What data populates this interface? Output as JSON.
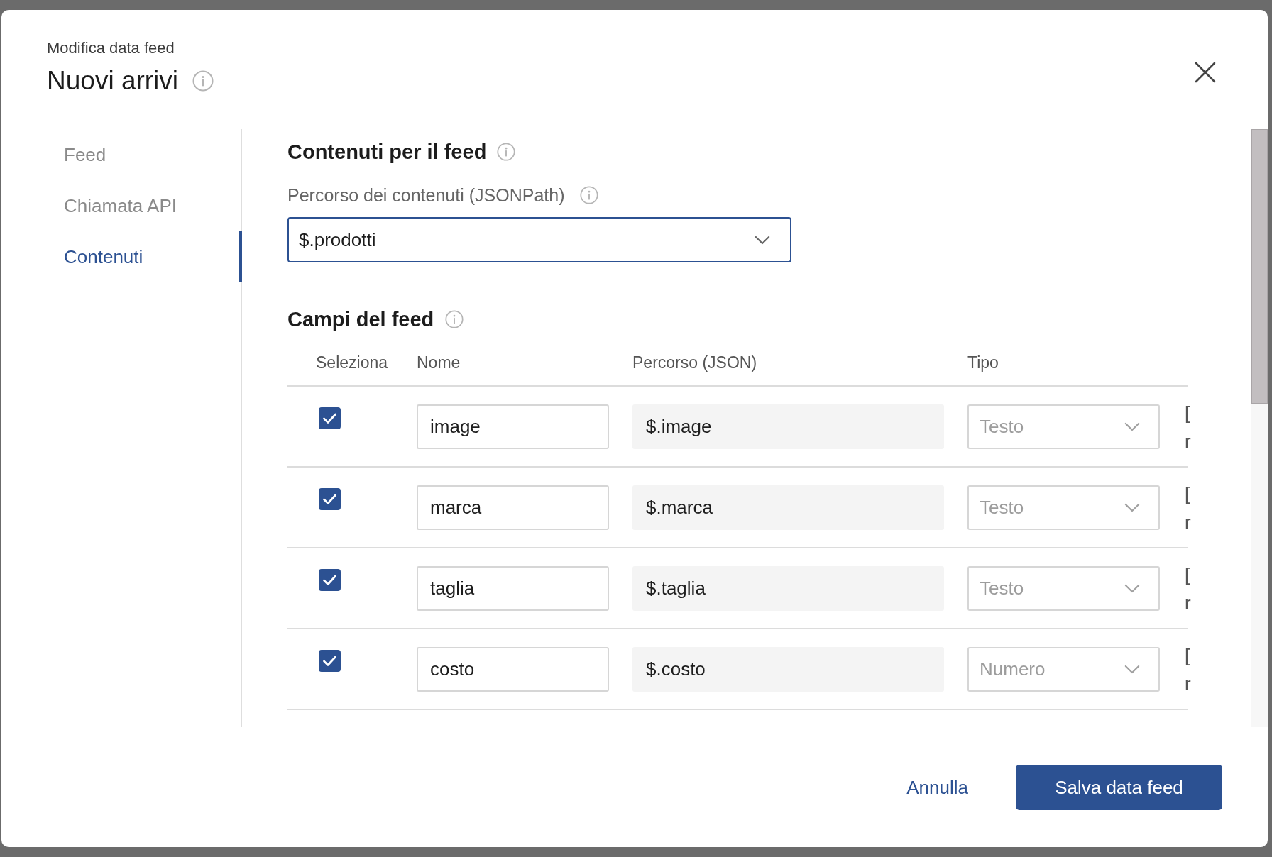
{
  "dialog": {
    "subtitle": "Modifica data feed",
    "title": "Nuovi arrivi"
  },
  "sidebar": {
    "items": [
      {
        "label": "Feed",
        "selected": false
      },
      {
        "label": "Chiamata API",
        "selected": false
      },
      {
        "label": "Contenuti",
        "selected": true
      }
    ]
  },
  "content_section": {
    "heading": "Contenuti per il feed",
    "field_label": "Percorso dei contenuti (JSONPath)",
    "value": "$.prodotti"
  },
  "fields_section": {
    "heading": "Campi del feed",
    "columns": [
      "Seleziona",
      "Nome",
      "Percorso (JSON)",
      "Tipo"
    ],
    "rows": [
      {
        "checked": true,
        "name": "image",
        "path": "$.image",
        "type": "Testo",
        "type_disabled": true,
        "column_5": [
          "[",
          "r"
        ]
      },
      {
        "checked": true,
        "name": "marca",
        "path": "$.marca",
        "type": "Testo",
        "type_disabled": true,
        "column_5": [
          "[",
          "r"
        ]
      },
      {
        "checked": true,
        "name": "taglia",
        "path": "$.taglia",
        "type": "Testo",
        "type_disabled": true,
        "column_5": [
          "[",
          "r"
        ]
      },
      {
        "checked": true,
        "name": "costo",
        "path": "$.costo",
        "type": "Numero",
        "type_disabled": true,
        "column_5": [
          "[",
          "r"
        ]
      }
    ]
  },
  "footer": {
    "cancel": "Annulla",
    "save": "Salva data feed"
  }
}
